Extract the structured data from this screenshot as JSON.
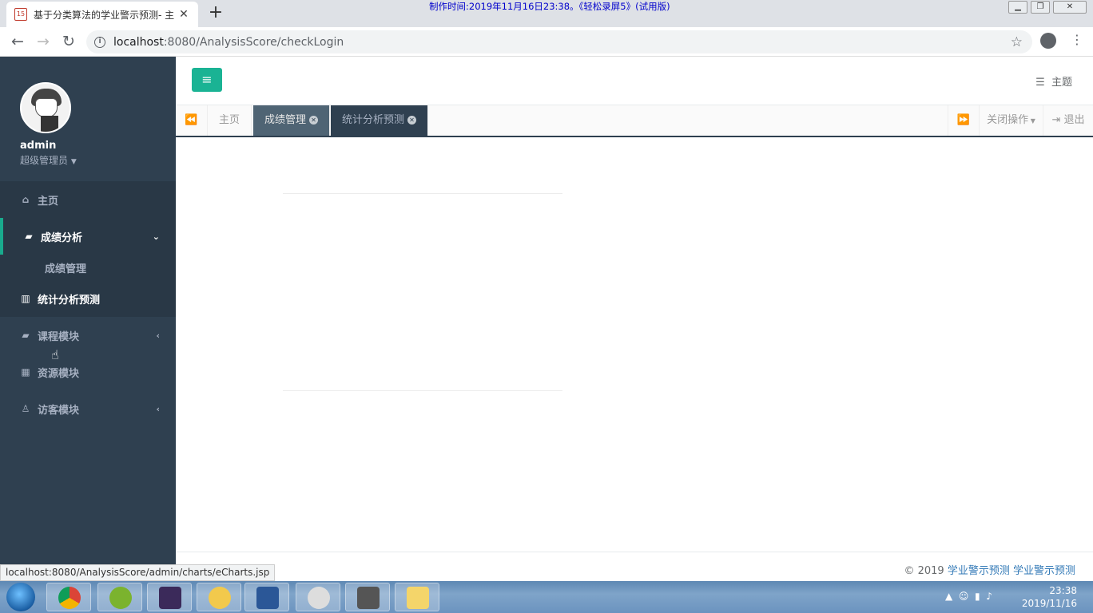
{
  "browser": {
    "tab_title": "基于分类算法的学业警示预测- 主",
    "tab_favicon_text": "15",
    "watermark": "制作时间:2019年11月16日23:38。《轻松录屏5》(试用版)",
    "url_host": "localhost",
    "url_rest": ":8080/AnalysisScore/checkLogin",
    "status_url": "localhost:8080/AnalysisScore/admin/charts/eCharts.jsp"
  },
  "user": {
    "name": "admin",
    "role": "超级管理员"
  },
  "sidebar": {
    "items": [
      {
        "label": "主页",
        "icon": "home-icon"
      },
      {
        "label": "成绩分析",
        "icon": "book-icon"
      },
      {
        "label": "成绩管理"
      },
      {
        "label": "统计分析预测",
        "icon": "bar-chart-icon"
      },
      {
        "label": "课程模块",
        "icon": "book-icon"
      },
      {
        "label": "资源模块",
        "icon": "table-icon"
      },
      {
        "label": "访客模块",
        "icon": "person-icon"
      }
    ]
  },
  "topbar": {
    "theme_label": "主题"
  },
  "tabs": {
    "items": [
      {
        "label": "主页"
      },
      {
        "label": "成绩管理"
      },
      {
        "label": "统计分析预测"
      }
    ],
    "close_ops": "关闭操作",
    "logout": "退出"
  },
  "footer": {
    "prefix": "© 2019",
    "link1": "学业警示预测",
    "link2": "学业警示预测"
  },
  "taskbar": {
    "time": "23:38",
    "date": "2019/11/16"
  },
  "colors": {
    "sidebar_bg": "#2f4050",
    "accent": "#1ab394"
  }
}
